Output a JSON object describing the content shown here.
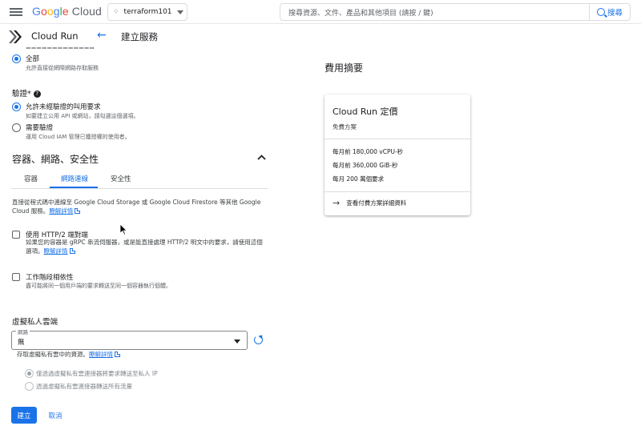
{
  "topbar": {
    "logo": {
      "google": [
        "G",
        "o",
        "o",
        "g",
        "l",
        "e"
      ],
      "cloud": "Cloud"
    },
    "project": "terraform101",
    "search_placeholder": "搜尋資源、文件、產品和其他項目 (請按 / 鍵)",
    "search_button": "搜尋"
  },
  "subbar": {
    "product": "Cloud Run",
    "page_title": "建立服務"
  },
  "ingress": {
    "all_label": "全部",
    "all_help": "允許直接從網際網路存取服務"
  },
  "auth": {
    "heading": "驗證*",
    "opt1_label": "允許未經驗證的叫用要求",
    "opt1_help": "如要建立公用 API 或網站，請勾選這個選項。",
    "opt2_label": "需要驗證",
    "opt2_help": "運用 Cloud IAM 管理已獲授權的使用者。"
  },
  "section": {
    "heading": "容器、網路、安全性",
    "tabs": [
      {
        "label": "容器"
      },
      {
        "label": "網路連線"
      },
      {
        "label": "安全性"
      }
    ],
    "intro": "直接從程式碼中連線至 Google Cloud Storage 或 Google Cloud Firestore 等其他 Google Cloud 服務。",
    "learn_more": "瞭解詳情"
  },
  "http2": {
    "label": "使用 HTTP/2 端對端",
    "help": "如果您的容器是 gRPC 串流伺服器，或是能直接處理 HTTP/2 明文中的要求，請使用這個選項。",
    "learn_more": "瞭解詳情"
  },
  "affinity": {
    "label": "工作階段相依性",
    "help": "盡可能將同一個用戶端的要求轉送至同一個容器執行個體。"
  },
  "vpc": {
    "heading": "虛擬私人雲端",
    "network_label": "網路",
    "network_value": "無",
    "help": "存取虛擬私有雲中的資源。",
    "learn_more": "瞭解詳情",
    "route_private": "僅透過虛擬私有雲連接器將要求轉送至私人 IP",
    "route_all": "透過虛擬私有雲連接器轉送所有流量"
  },
  "actions": {
    "create": "建立",
    "cancel": "取消"
  },
  "cost": {
    "heading": "費用摘要",
    "card_title": "Cloud Run 定價",
    "card_sub": "免費方案",
    "lines": [
      "每月前 180,000 vCPU-秒",
      "每月前 360,000 GiB-秒",
      "每月 200 萬個要求"
    ],
    "link": "查看付費方案詳細資料"
  },
  "colors": {
    "accent": "#1a73e8",
    "text": "#202124",
    "muted": "#5f6368"
  }
}
